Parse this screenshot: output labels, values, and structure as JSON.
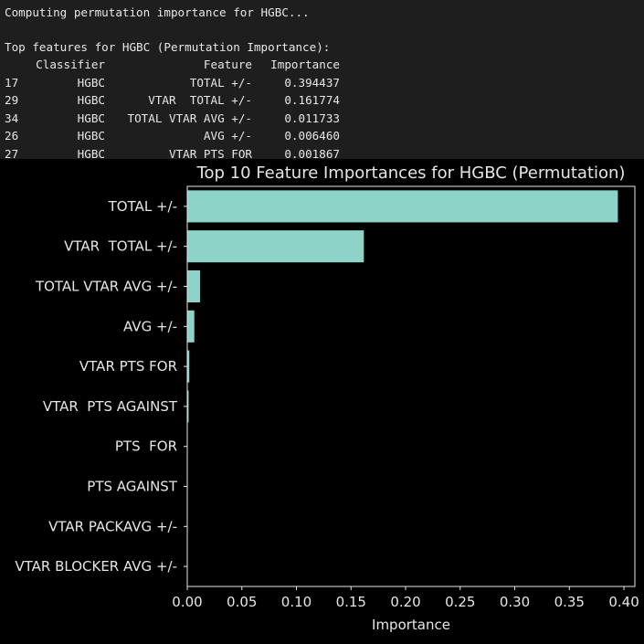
{
  "console": {
    "status_line": "Computing permutation importance for HGBC...",
    "table_title": "Top features for HGBC (Permutation Importance):",
    "headers": {
      "classifier": "Classifier",
      "feature": "Feature",
      "importance": "Importance"
    },
    "rows": [
      {
        "idx": "17",
        "classifier": "HGBC",
        "feature": "TOTAL +/-",
        "importance": "0.394437"
      },
      {
        "idx": "29",
        "classifier": "HGBC",
        "feature": "VTAR  TOTAL +/-",
        "importance": "0.161774"
      },
      {
        "idx": "34",
        "classifier": "HGBC",
        "feature": "TOTAL VTAR AVG +/-",
        "importance": "0.011733"
      },
      {
        "idx": "26",
        "classifier": "HGBC",
        "feature": "AVG +/-",
        "importance": "0.006460"
      },
      {
        "idx": "27",
        "classifier": "HGBC",
        "feature": "VTAR PTS FOR",
        "importance": "0.001867"
      }
    ]
  },
  "chart_data": {
    "type": "bar",
    "orientation": "horizontal",
    "title": "Top 10 Feature Importances for HGBC (Permutation)",
    "xlabel": "Importance",
    "ylabel": "",
    "xlim": [
      0,
      0.41
    ],
    "xticks": [
      "0.00",
      "0.05",
      "0.10",
      "0.15",
      "0.20",
      "0.25",
      "0.30",
      "0.35",
      "0.40"
    ],
    "categories": [
      "TOTAL +/-",
      "VTAR  TOTAL +/-",
      "TOTAL VTAR AVG +/-",
      "AVG +/-",
      "VTAR PTS FOR",
      "VTAR  PTS AGAINST",
      "PTS  FOR",
      "PTS AGAINST",
      "VTAR PACKAVG +/-",
      "VTAR BLOCKER AVG +/-"
    ],
    "values": [
      0.394437,
      0.161774,
      0.011733,
      0.00646,
      0.001867,
      0.0012,
      0.0,
      0.0,
      0.0,
      0.0
    ],
    "bar_color": "#8dd3c7",
    "background": "#000000",
    "grid": false,
    "legend": "none"
  }
}
